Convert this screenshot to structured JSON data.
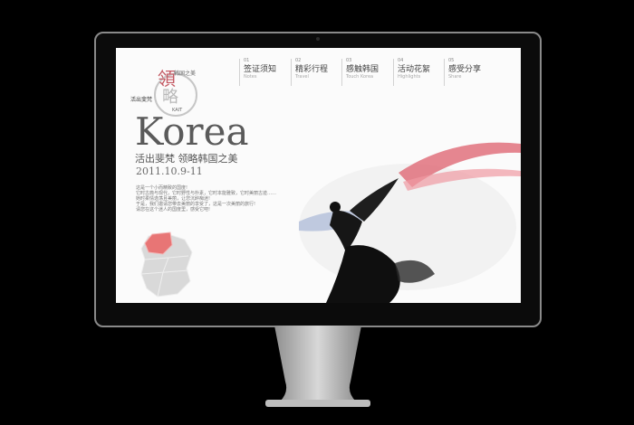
{
  "brand": {
    "hanja_main": "領",
    "hanja_sub": "略",
    "tag_top": "韩国之美",
    "tag_left": "活出斐梵",
    "tag_small": "KAIT"
  },
  "nav": [
    {
      "num": "01",
      "label": "签证须知",
      "sub": "Notes"
    },
    {
      "num": "02",
      "label": "精彩行程",
      "sub": "Travel"
    },
    {
      "num": "03",
      "label": "感触韩国",
      "sub": "Touch Korea"
    },
    {
      "num": "04",
      "label": "活动花絮",
      "sub": "Highlights"
    },
    {
      "num": "05",
      "label": "感受分享",
      "sub": "Share"
    }
  ],
  "hero": {
    "title": "Korea",
    "subtitle": "活出斐梵  领略韩国之美",
    "date": "2011.10.9-11"
  },
  "intro": [
    "这是一个小而精致的国度!",
    "它时古典与现代，它时野性与朴素，它时本能雅致，它时美丽古迹……",
    "她时柔情逸荡且美丽，让您沉醉痴迷!",
    "于是，我们邀请您带去美丽的享受了，这是一次美丽的旅行!",
    "请您在这个迷人的国度里，感受它吧!"
  ],
  "colors": {
    "accent": "#c45a64",
    "map_highlight": "#e87575",
    "map_base": "#d9d9d9"
  }
}
